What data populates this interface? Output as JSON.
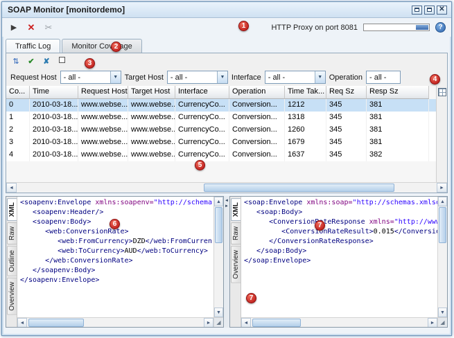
{
  "window": {
    "title": "SOAP Monitor [monitordemo]"
  },
  "icons": {
    "play": "▶",
    "stop_x": "✕",
    "scissors": "✂",
    "help": "?",
    "mini_sort": "⇅",
    "mini_check": "✔",
    "mini_clear": "✘",
    "combo_arrow": "▼",
    "arrow_left": "◄",
    "arrow_right": "►",
    "arrow_up": "▲",
    "arrow_down": "▼",
    "divider_left": "◄",
    "divider_right": "►",
    "corner_glyph": "◢"
  },
  "toolbar": {
    "proxy_label": "HTTP Proxy on port 8081"
  },
  "tabs": [
    {
      "label": "Traffic Log"
    },
    {
      "label": "Monitor Coverage"
    }
  ],
  "filters": [
    {
      "label": "Request Host",
      "value": "- all -"
    },
    {
      "label": "Target Host",
      "value": "- all -"
    },
    {
      "label": "Interface",
      "value": "- all -"
    },
    {
      "label": "Operation",
      "value": "- all -"
    }
  ],
  "table": {
    "columns": [
      "Co...",
      "Time",
      "Request Host",
      "Target Host",
      "Interface",
      "Operation",
      "Time Tak...",
      "Req Sz",
      "Resp Sz"
    ],
    "rows": [
      [
        "0",
        "2010-03-18...",
        "www.webse...",
        "www.webse...",
        "CurrencyCo...",
        "Conversion...",
        "1212",
        "345",
        "381"
      ],
      [
        "1",
        "2010-03-18...",
        "www.webse...",
        "www.webse...",
        "CurrencyCo...",
        "Conversion...",
        "1318",
        "345",
        "381"
      ],
      [
        "2",
        "2010-03-18...",
        "www.webse...",
        "www.webse...",
        "CurrencyCo...",
        "Conversion...",
        "1260",
        "345",
        "381"
      ],
      [
        "3",
        "2010-03-18...",
        "www.webse...",
        "www.webse...",
        "CurrencyCo...",
        "Conversion...",
        "1679",
        "345",
        "381"
      ],
      [
        "4",
        "2010-03-18...",
        "www.webse...",
        "www.webse...",
        "CurrencyCo...",
        "Conversion...",
        "1637",
        "345",
        "382"
      ]
    ],
    "selected_row": 0
  },
  "request_panel": {
    "tabs": [
      "XML",
      "Raw",
      "Outline",
      "Overview"
    ],
    "active_tab": 0,
    "lines": [
      [
        {
          "t": "<soapenv:Envelope ",
          "c": "tag"
        },
        {
          "t": "xmlns:soapenv=",
          "c": "attr"
        },
        {
          "t": "\"http://schema",
          "c": "str"
        }
      ],
      [
        {
          "t": "   <soapenv:Header/>",
          "c": "tag"
        }
      ],
      [
        {
          "t": "   <soapenv:Body>",
          "c": "tag"
        }
      ],
      [
        {
          "t": "      <web:ConversionRate>",
          "c": "tag"
        }
      ],
      [
        {
          "t": "         <web:FromCurrency>",
          "c": "tag"
        },
        {
          "t": "DZD",
          "c": "txt"
        },
        {
          "t": "</web:FromCurren",
          "c": "tag"
        }
      ],
      [
        {
          "t": "         <web:ToCurrency>",
          "c": "tag"
        },
        {
          "t": "AUD",
          "c": "txt"
        },
        {
          "t": "</web:ToCurrency>",
          "c": "tag"
        }
      ],
      [
        {
          "t": "      </web:ConversionRate>",
          "c": "tag"
        }
      ],
      [
        {
          "t": "   </soapenv:Body>",
          "c": "tag"
        }
      ],
      [
        {
          "t": "</soapenv:Envelope>",
          "c": "tag"
        }
      ]
    ]
  },
  "response_panel": {
    "tabs": [
      "XML",
      "Raw",
      "Overview"
    ],
    "active_tab": 0,
    "lines": [
      [
        {
          "t": "<soap:Envelope ",
          "c": "tag"
        },
        {
          "t": "xmlns:soap=",
          "c": "attr"
        },
        {
          "t": "\"http://schemas.xmlsoap.org/",
          "c": "str"
        }
      ],
      [
        {
          "t": "   <soap:Body>",
          "c": "tag"
        }
      ],
      [
        {
          "t": "      <ConversionRateResponse ",
          "c": "tag"
        },
        {
          "t": "xmlns=",
          "c": "attr"
        },
        {
          "t": "\"http://www.webse",
          "c": "str"
        }
      ],
      [
        {
          "t": "         <ConversionRateResult>",
          "c": "tag"
        },
        {
          "t": "0.015",
          "c": "txt"
        },
        {
          "t": "</ConversionRateResu",
          "c": "tag"
        }
      ],
      [
        {
          "t": "      </ConversionRateResponse>",
          "c": "tag"
        }
      ],
      [
        {
          "t": "   </soap:Body>",
          "c": "tag"
        }
      ],
      [
        {
          "t": "</soap:Envelope>",
          "c": "tag"
        }
      ]
    ]
  },
  "callouts": [
    "1",
    "2",
    "3",
    "4",
    "5",
    "6",
    "7",
    "7"
  ]
}
